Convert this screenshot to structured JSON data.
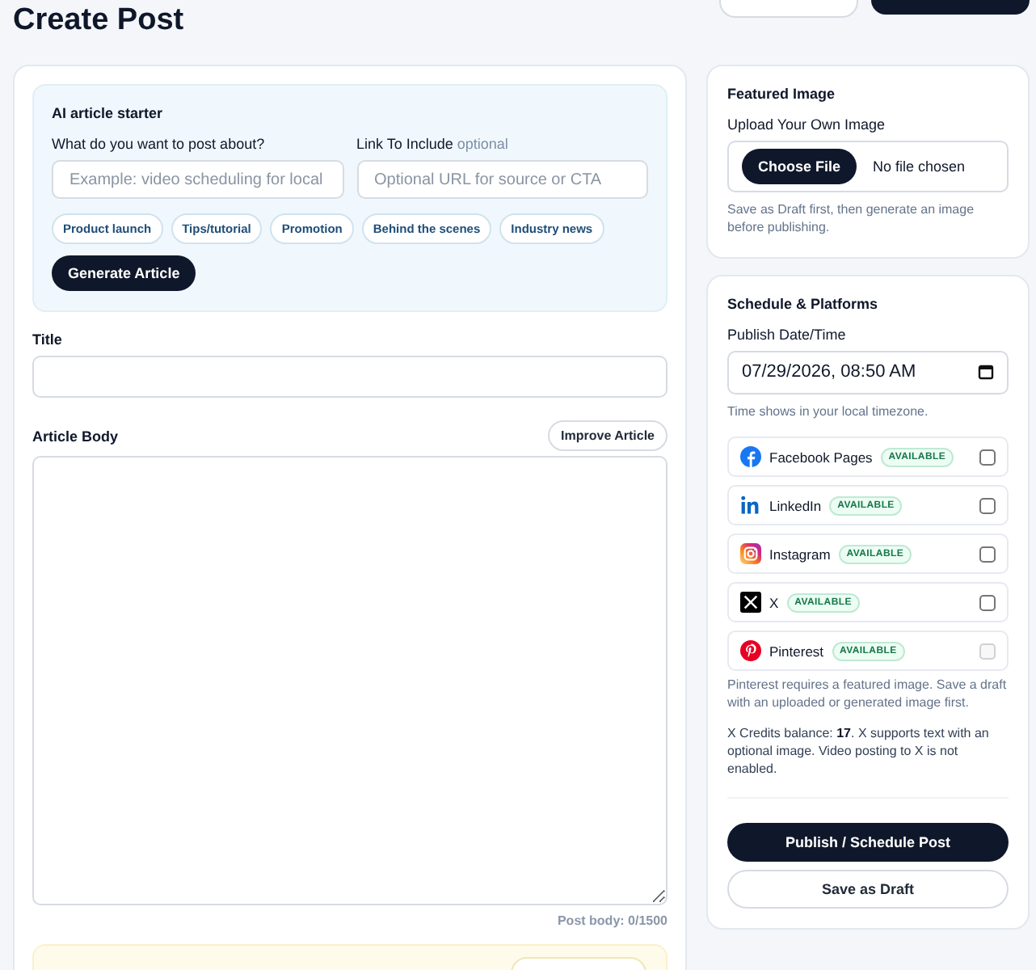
{
  "page": {
    "title": "Create Post"
  },
  "ai_starter": {
    "heading": "AI article starter",
    "topic": {
      "label": "What do you want to post about?",
      "placeholder": "Example: video scheduling for local"
    },
    "link": {
      "label": "Link To Include",
      "hint": "optional",
      "placeholder": "Optional URL for source or CTA"
    },
    "chips": [
      "Product launch",
      "Tips/tutorial",
      "Promotion",
      "Behind the scenes",
      "Industry news"
    ],
    "button": "Generate Article"
  },
  "title_field": {
    "label": "Title"
  },
  "body_field": {
    "label": "Article Body",
    "button": "Improve Article",
    "counter": "Post body: 0/1500"
  },
  "featured_image": {
    "heading": "Featured Image",
    "label": "Upload Your Own Image",
    "button": "Choose File",
    "status": "No file chosen",
    "note": "Save as Draft first, then generate an image before publishing."
  },
  "schedule": {
    "heading": "Schedule & Platforms",
    "label": "Publish Date/Time",
    "value": "07/29/2026, 08:50 AM",
    "note": "Time shows in your local timezone.",
    "platforms": [
      {
        "kind": "facebook",
        "name": "Facebook Pages",
        "badge": "AVAILABLE",
        "checked": false,
        "disabled": false
      },
      {
        "kind": "linkedin",
        "name": "LinkedIn",
        "badge": "AVAILABLE",
        "checked": false,
        "disabled": false
      },
      {
        "kind": "instagram",
        "name": "Instagram",
        "badge": "AVAILABLE",
        "checked": false,
        "disabled": false
      },
      {
        "kind": "x",
        "name": "X",
        "badge": "AVAILABLE",
        "checked": false,
        "disabled": false
      },
      {
        "kind": "pinterest",
        "name": "Pinterest",
        "badge": "AVAILABLE",
        "checked": false,
        "disabled": true
      }
    ],
    "pinterest_note": "Pinterest requires a featured image. Save a draft with an uploaded or generated image first.",
    "credits_note": "X Credits balance: **17**. X supports text with an optional image. Video posting to X is not enabled.",
    "publish_button": "Publish / Schedule Post",
    "draft_button": "Save as Draft"
  }
}
